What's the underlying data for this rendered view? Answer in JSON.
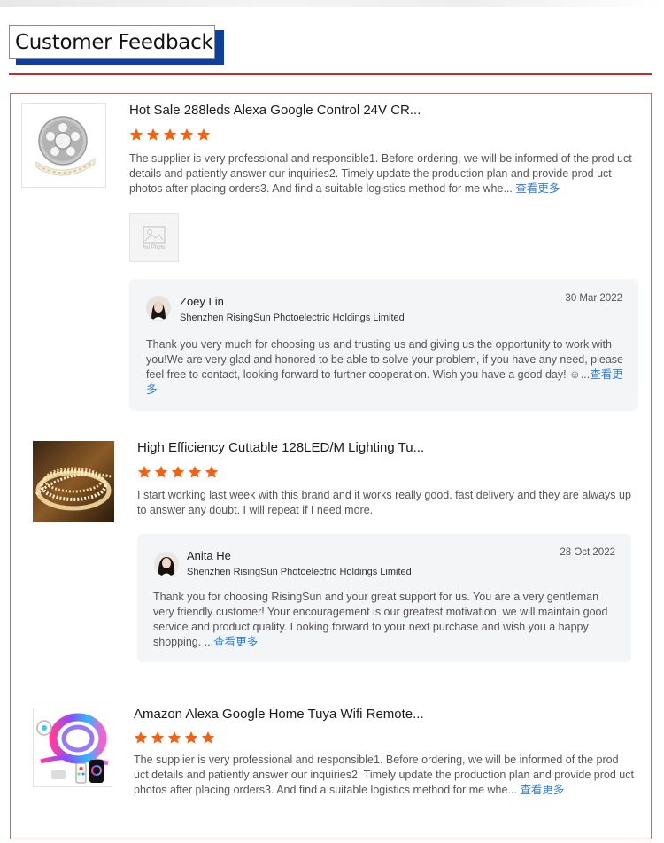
{
  "header": {
    "title": "Customer Feedback"
  },
  "colors": {
    "accent_red": "#d42424",
    "title_shadow_blue": "#0b3fa0",
    "star_orange": "#f5610e",
    "link_blue": "#2f7ddf"
  },
  "feedback": [
    {
      "product_title": "Hot Sale 288leds Alexa Google Control 24V CR...",
      "rating": 5,
      "review": "The supplier is very professional and responsible1. Before ordering, we will be informed of the prod uct details and patiently answer our inquiries2. Timely update the production plan and provide prod uct photos after placing orders3. And find a suitable logistics method for me whe...",
      "more": "查看更多",
      "no_photo_label": "No Photo",
      "reply": {
        "name": "Zoey Lin",
        "company": "Shenzhen RisingSun Photoelectric Holdings Limited",
        "date": "30 Mar 2022",
        "text": "Thank you very much for choosing us and trusting us and giving us the opportunity to work with you!We are very glad and honored to be able to solve your problem, if you have any need, please feel free to contact, looking forward to further cooperation. Wish you have a good day! ☺...",
        "more": "查看更多"
      }
    },
    {
      "product_title": "High Efficiency Cuttable 128LED/M Lighting Tu...",
      "rating": 5,
      "review": "I start working last week with this brand and it works really good. fast delivery and they are always up to answer any doubt. I will repeat if I need more.",
      "reply": {
        "name": "Anita He",
        "company": "Shenzhen RisingSun Photoelectric Holdings Limited",
        "date": "28 Oct 2022",
        "text": "Thank you for choosing RisingSun and your great support for us. You are a very gentleman very friendly customer! Your encouragement is our greatest motivation, we will maintain good service and product quality. Looking forward to your next purchase and wish you a happy shopping. ...",
        "more": "查看更多"
      }
    },
    {
      "product_title": "Amazon Alexa Google Home Tuya Wifi Remote...",
      "rating": 5,
      "review": "The supplier is very professional and responsible1. Before ordering, we will be informed of the prod uct details and patiently answer our inquiries2. Timely update the production plan and provide prod uct photos after placing orders3. And find a suitable logistics method for me whe...",
      "more": "查看更多"
    }
  ]
}
